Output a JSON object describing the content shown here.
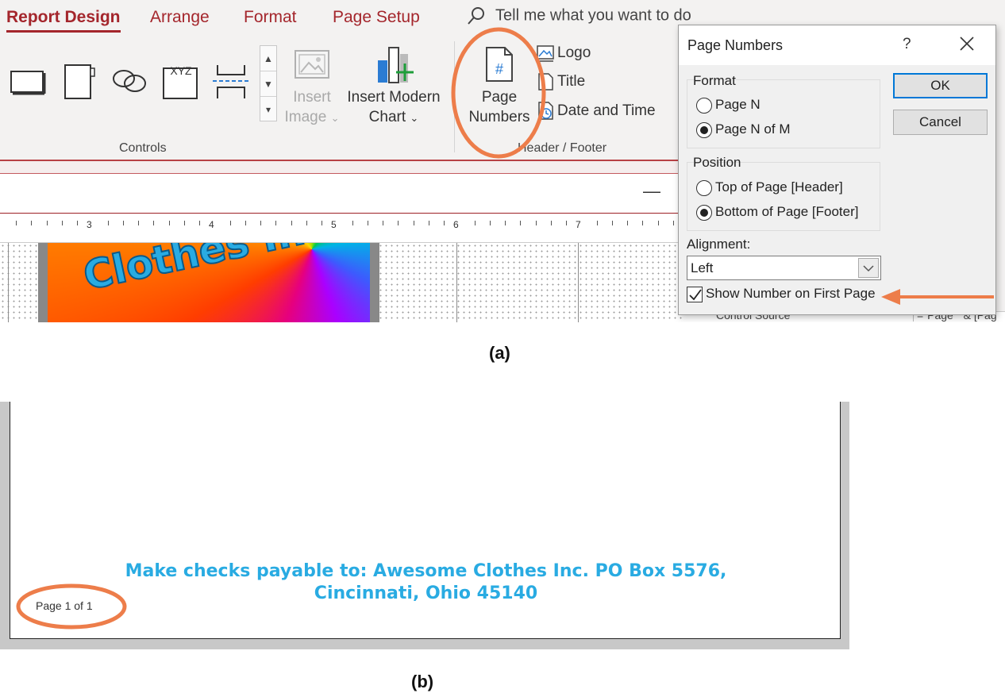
{
  "ribbon": {
    "tabs": [
      "Report Design",
      "Arrange",
      "Format",
      "Page Setup"
    ],
    "active_tab": "Report Design",
    "tell_me": "Tell me what you want to do",
    "controls": {
      "xyz_label": "XYZ",
      "insert_image": [
        "Insert",
        "Image"
      ],
      "insert_chart": [
        "Insert Modern",
        "Chart"
      ],
      "group_label": "Controls"
    },
    "header_footer": {
      "page_numbers": [
        "Page",
        "Numbers"
      ],
      "page_numbers_glyph": "#",
      "logo": "Logo",
      "title": "Title",
      "date_time": "Date and Time",
      "group_label": "Header / Footer"
    },
    "accent_color": "#a4262c"
  },
  "designer": {
    "minimize": "—",
    "ruler_numbers": [
      "3",
      "4",
      "5",
      "6",
      "7"
    ],
    "logo_text": "Clothes Inc",
    "property_sheet": {
      "label": "Control Source",
      "value": "=\"Page \" & [Pag"
    }
  },
  "dialog": {
    "title": "Page Numbers",
    "help": "?",
    "format": {
      "legend": "Format",
      "options": [
        "Page N",
        "Page N of M"
      ],
      "selected": "Page N of M"
    },
    "position": {
      "legend": "Position",
      "options": [
        "Top of Page [Header]",
        "Bottom of Page [Footer]"
      ],
      "selected": "Bottom of Page [Footer]"
    },
    "alignment": {
      "label": "Alignment:",
      "value": "Left"
    },
    "show_first_page": {
      "label": "Show Number on First Page",
      "checked": true
    },
    "ok": "OK",
    "cancel": "Cancel"
  },
  "captions": {
    "a": "(a)",
    "b": "(b)"
  },
  "report": {
    "footer_lines": [
      "Make checks payable to: Awesome Clothes Inc. PO Box 5576,",
      "Cincinnati, Ohio 45140"
    ],
    "page_number": "Page 1 of 1",
    "text_color": "#29abe2"
  },
  "annotation_color": "#ed7d4a"
}
